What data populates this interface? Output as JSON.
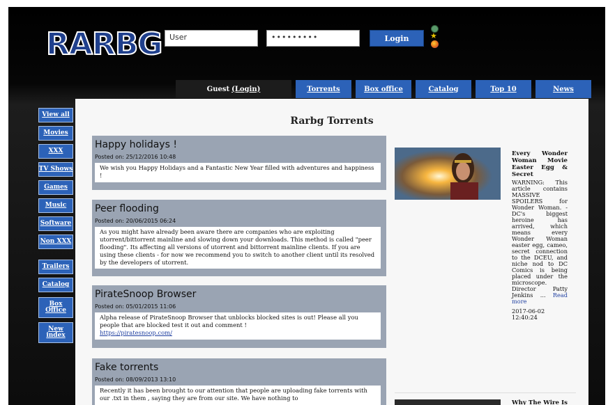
{
  "header": {
    "logo": "RARBG",
    "username_value": "User",
    "password_value": "•••••••••",
    "login_label": "Login"
  },
  "tabs": {
    "guest_prefix": "Guest",
    "guest_login_link": "(Login)",
    "items": [
      "Torrents",
      "Box office",
      "Catalog",
      "Top 10",
      "News"
    ]
  },
  "sidebar": {
    "items": [
      "View all",
      "Movies",
      "XXX",
      "TV Shows",
      "Games",
      "Music",
      "Software",
      "Non XXX",
      "Trailers",
      "Catalog",
      "Box Office",
      "New index"
    ]
  },
  "main": {
    "title": "Rarbg Torrents",
    "news": [
      {
        "title": "Happy holidays !",
        "date": "Posted on: 25/12/2016 10:48",
        "body": "We wish you Happy Holidays and a Fantastic New Year filled with adventures and happiness !"
      },
      {
        "title": "Peer flooding",
        "date": "Posted on: 20/06/2015 06:24",
        "body": "As you might have already been aware there are companies who are exploiting utorrent/bittorrent mainline and slowing down your downloads. This method is called \"peer flooding\". Its affecting all versions of utorrent and bittorrent mainline clients. If you are using these clients - for now we recommend you to switch to another client until its resolved by the developers of utorrent."
      },
      {
        "title": "PirateSnoop Browser",
        "date": "Posted on: 05/01/2015 11:06",
        "body": "Alpha release of PirateSnoop Browser that unblocks blocked sites is out! Please all you people that are blocked test it out and comment !",
        "link": "https://piratesnoop.com/"
      },
      {
        "title": "Fake torrents",
        "date": "Posted on: 08/09/2013 13:10",
        "body": "Recently it has been brought to our attention that people are uploading fake torrents with our .txt in them , saying they are from our site. We have nothing to"
      }
    ]
  },
  "articles": [
    {
      "title": "Every Wonder Woman Movie Easter Egg & Secret",
      "body": "WARNING: This article contains MASSIVE SPOILERS for Wonder Woman. - DC's biggest heroine has arrived, which means every Wonder Woman easter egg, cameo, secret connection to the DCEU, and niche nod to DC Comics is being placed under the microscope. Director Patty Jenkins ...",
      "read_more": "Read more",
      "date": "2017-06-02 12:40:24"
    },
    {
      "title": "Why The Wire Is The Best TV"
    }
  ],
  "colors": {
    "accent_blue": "#2c62b8",
    "news_box": "#9aa4b3",
    "logo_blue": "#1f3f8c"
  }
}
